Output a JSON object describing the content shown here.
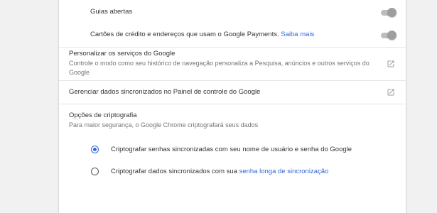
{
  "sync_items": [
    {
      "label": "Guias abertas",
      "enabled": false
    },
    {
      "label": "Cartões de crédito e endereços que usam o Google Payments.",
      "link": "Saiba mais",
      "enabled": false
    }
  ],
  "personalize": {
    "title": "Personalizar os serviços do Google",
    "description": "Controle o modo como seu histórico de navegação personaliza a Pesquisa, anúncios e outros serviços do Google"
  },
  "manage": {
    "title": "Gerenciar dados sincronizados no Painel de controle do Google"
  },
  "encryption": {
    "title": "Opções de criptografia",
    "description": "Para maior segurança, o Google Chrome criptografará seus dados",
    "options": [
      {
        "label": "Criptografar senhas sincronizadas com seu nome de usuário e senha do Google",
        "selected": true
      },
      {
        "label": "Criptografar dados sincronizados com sua",
        "link": "senha longa de sincronização",
        "selected": false
      }
    ]
  },
  "colors": {
    "accent": "#3367d6",
    "background": "#f1f1f1",
    "card": "#ffffff",
    "toggle_off": "#9e9e9e"
  },
  "icons": {
    "external_link": "open-in-new-icon"
  }
}
